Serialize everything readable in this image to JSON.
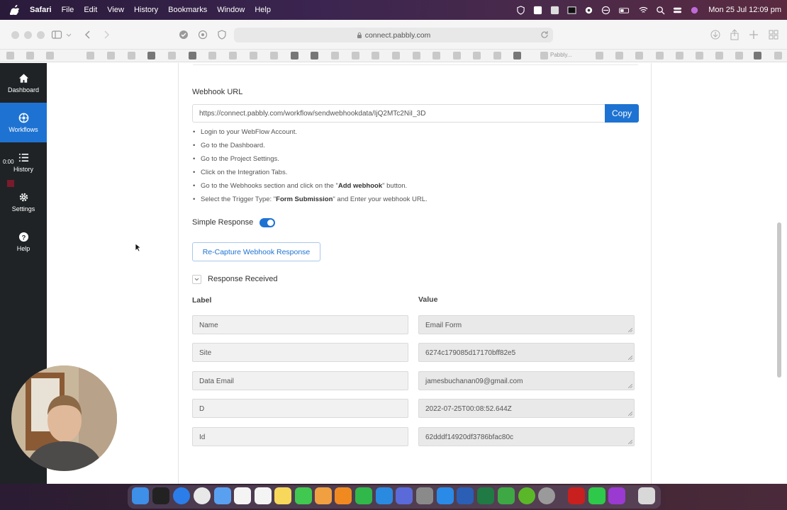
{
  "menubar": {
    "app": "Safari",
    "items": [
      "File",
      "Edit",
      "View",
      "History",
      "Bookmarks",
      "Window",
      "Help"
    ],
    "clock": "Mon 25 Jul  12:09 pm"
  },
  "browser": {
    "url": "connect.pabbly.com",
    "favorites_label": "Pabbly..."
  },
  "sidebar": {
    "timer": "0:00",
    "items": [
      {
        "label": "Dashboard",
        "icon": "home-icon"
      },
      {
        "label": "Workflows",
        "icon": "workflow-icon",
        "active": true
      },
      {
        "label": "History",
        "icon": "list-icon"
      },
      {
        "label": "Settings",
        "icon": "gear-icon"
      },
      {
        "label": "Help",
        "icon": "help-icon"
      }
    ]
  },
  "webhook": {
    "label": "Webhook URL",
    "url": "https://connect.pabbly.com/workflow/sendwebhookdata/IjQ2MTc2NiI_3D",
    "copy_label": "Copy"
  },
  "steps": [
    {
      "pre": "Login to your WebFlow Account.",
      "bold": "",
      "post": ""
    },
    {
      "pre": "Go to the Dashboard.",
      "bold": "",
      "post": ""
    },
    {
      "pre": "Go to the Project Settings.",
      "bold": "",
      "post": ""
    },
    {
      "pre": "Click on the Integration Tabs.",
      "bold": "",
      "post": ""
    },
    {
      "pre": "Go to the Webhooks section and click on the \"",
      "bold": "Add webhook",
      "post": "\" button."
    },
    {
      "pre": "Select the Trigger Type: \"",
      "bold": "Form Submission",
      "post": "\" and Enter your webhook URL."
    }
  ],
  "simple_response": {
    "label": "Simple Response",
    "enabled": true
  },
  "recapture_label": "Re-Capture Webhook Response",
  "response_received_label": "Response Received",
  "table": {
    "label_header": "Label",
    "value_header": "Value",
    "rows": [
      {
        "label": "Name",
        "value": "Email Form"
      },
      {
        "label": "Site",
        "value": "6274c179085d17170bff82e5"
      },
      {
        "label": "Data Email",
        "value": "jamesbuchanan09@gmail.com"
      },
      {
        "label": "D",
        "value": "2022-07-25T00:08:52.644Z"
      },
      {
        "label": "Id",
        "value": "62dddf14920df3786bfac80c"
      }
    ]
  },
  "colors": {
    "accent": "#1e73d2",
    "sidebar_bg": "#1f2326"
  }
}
